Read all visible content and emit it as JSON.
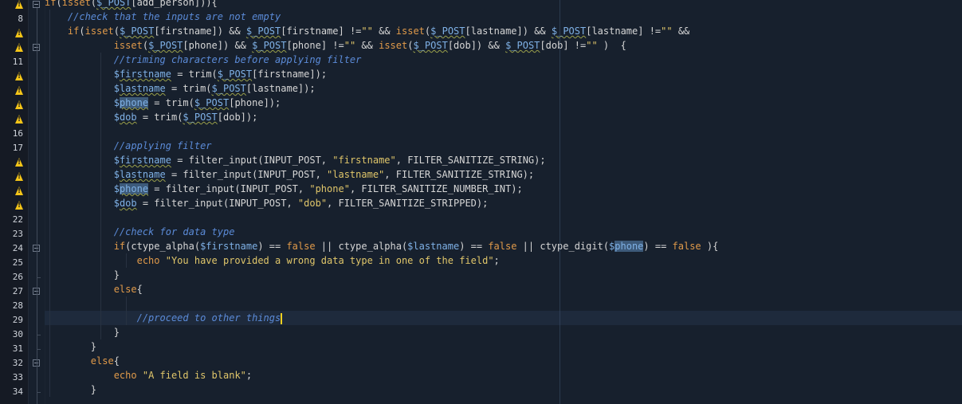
{
  "editor": {
    "language": "php",
    "warning_icon": "warning-triangle-icon",
    "fold_icon": "fold-minus-icon",
    "lines": [
      {
        "num": "",
        "warn": true,
        "fold": true,
        "html": "<span class=\"kw\">if</span>(<span class=\"kw\">isset</span>(<span class=\"var sq\">$_POST</span>[add_person])){"
      },
      {
        "num": "8",
        "warn": false,
        "fold": false,
        "html": "    <span class=\"cm\">//check that the inputs are not empty</span>"
      },
      {
        "num": "",
        "warn": true,
        "fold": false,
        "html": "    <span class=\"kw\">if</span>(<span class=\"kw\">isset</span>(<span class=\"var sq\">$_POST</span>[firstname]) &amp;&amp; <span class=\"var sq\">$_POST</span>[firstname] !=<span class=\"str\">\"\"</span> &amp;&amp; <span class=\"kw\">isset</span>(<span class=\"var sq\">$_POST</span>[lastname]) &amp;&amp; <span class=\"var sq\">$_POST</span>[lastname] !=<span class=\"str\">\"\"</span> &amp;&amp;"
      },
      {
        "num": "",
        "warn": true,
        "fold": true,
        "html": "            <span class=\"kw\">isset</span>(<span class=\"var sq\">$_POST</span>[phone]) &amp;&amp; <span class=\"var sq\">$_POST</span>[phone] !=<span class=\"str\">\"\"</span> &amp;&amp; <span class=\"kw\">isset</span>(<span class=\"var sq\">$_POST</span>[dob]) &amp;&amp; <span class=\"var sq\">$_POST</span>[dob] !=<span class=\"str\">\"\"</span> )  {"
      },
      {
        "num": "11",
        "warn": false,
        "fold": false,
        "html": "            <span class=\"cm\">//triming characters before applying filter</span>"
      },
      {
        "num": "",
        "warn": true,
        "fold": false,
        "html": "            <span class=\"var\">$<span class=\"sq\">firstname</span></span> = trim(<span class=\"var sq\">$_POST</span>[firstname]);"
      },
      {
        "num": "",
        "warn": true,
        "fold": false,
        "html": "            <span class=\"var\">$<span class=\"sq\">lastname</span></span> = trim(<span class=\"var sq\">$_POST</span>[lastname]);"
      },
      {
        "num": "",
        "warn": true,
        "fold": false,
        "html": "            <span class=\"var\">$<span class=\"sel sq\">phone</span></span> = trim(<span class=\"var sq\">$_POST</span>[phone]);"
      },
      {
        "num": "",
        "warn": true,
        "fold": false,
        "html": "            <span class=\"var\">$<span class=\"sq\">dob</span></span> = trim(<span class=\"var sq\">$_POST</span>[dob]);"
      },
      {
        "num": "16",
        "warn": false,
        "fold": false,
        "html": ""
      },
      {
        "num": "17",
        "warn": false,
        "fold": false,
        "html": "            <span class=\"cm\">//applying filter</span>"
      },
      {
        "num": "",
        "warn": true,
        "fold": false,
        "html": "            <span class=\"var\">$<span class=\"sq\">firstname</span></span> = filter_input(INPUT_POST, <span class=\"str\">\"firstname\"</span>, FILTER_SANITIZE_STRING);"
      },
      {
        "num": "",
        "warn": true,
        "fold": false,
        "html": "            <span class=\"var\">$<span class=\"sq\">lastname</span></span> = filter_input(INPUT_POST, <span class=\"str\">\"lastname\"</span>, FILTER_SANITIZE_STRING);"
      },
      {
        "num": "",
        "warn": true,
        "fold": false,
        "html": "            <span class=\"var\">$<span class=\"sel sq\">phone</span></span> = filter_input(INPUT_POST, <span class=\"str\">\"phone\"</span>, FILTER_SANITIZE_NUMBER_INT);"
      },
      {
        "num": "",
        "warn": true,
        "fold": false,
        "html": "            <span class=\"var\">$<span class=\"sq\">dob</span></span> = filter_input(INPUT_POST, <span class=\"str\">\"dob\"</span>, FILTER_SANITIZE_STRIPPED);"
      },
      {
        "num": "22",
        "warn": false,
        "fold": false,
        "html": ""
      },
      {
        "num": "23",
        "warn": false,
        "fold": false,
        "html": "            <span class=\"cm\">//check for data type</span>"
      },
      {
        "num": "24",
        "warn": false,
        "fold": true,
        "html": "            <span class=\"kw\">if</span>(ctype_alpha(<span class=\"var\">$firstname</span>) == <span class=\"kw\">false</span> || ctype_alpha(<span class=\"var\">$lastname</span>) == <span class=\"kw\">false</span> || ctype_digit(<span class=\"var\">$<span class=\"sel\">phone</span></span>) == <span class=\"kw\">false</span> ){"
      },
      {
        "num": "25",
        "warn": false,
        "fold": false,
        "html": "                <span class=\"kw\">echo</span> <span class=\"str\">\"You have provided a wrong data type in one of the field\"</span>;"
      },
      {
        "num": "26",
        "warn": false,
        "fold": false,
        "html": "            }"
      },
      {
        "num": "27",
        "warn": false,
        "fold": true,
        "html": "            <span class=\"kw\">else</span>{"
      },
      {
        "num": "28",
        "warn": false,
        "fold": false,
        "html": ""
      },
      {
        "num": "29",
        "warn": false,
        "fold": false,
        "html": "                <span class=\"cm\">//proceed to other things</span><span class=\"caret\"></span>",
        "current": true
      },
      {
        "num": "30",
        "warn": false,
        "fold": false,
        "html": "            }"
      },
      {
        "num": "31",
        "warn": false,
        "fold": false,
        "html": "        }"
      },
      {
        "num": "32",
        "warn": false,
        "fold": true,
        "html": "        <span class=\"kw\">else</span>{"
      },
      {
        "num": "33",
        "warn": false,
        "fold": false,
        "html": "            <span class=\"kw\">echo</span> <span class=\"str\">\"A field is blank\"</span>;"
      },
      {
        "num": "34",
        "warn": false,
        "fold": false,
        "html": "        }"
      }
    ]
  }
}
